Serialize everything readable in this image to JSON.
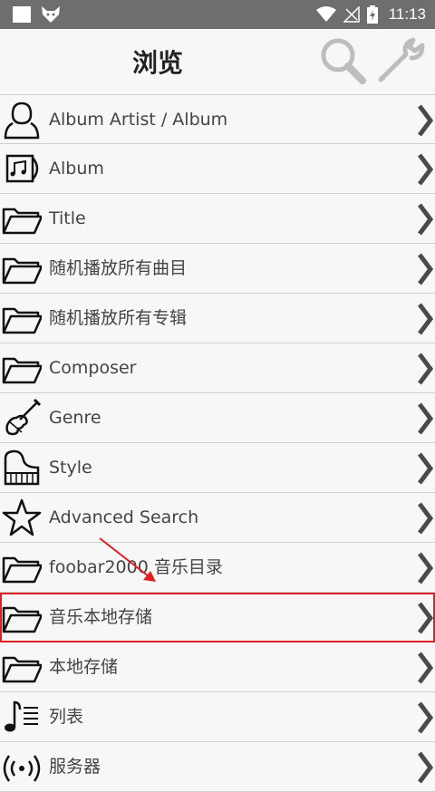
{
  "status": {
    "time": "11:13"
  },
  "header": {
    "title": "浏览"
  },
  "items": [
    {
      "label": "Album Artist / Album",
      "icon": "person-icon"
    },
    {
      "label": "Album",
      "icon": "album-icon"
    },
    {
      "label": "Title",
      "icon": "folder-icon"
    },
    {
      "label": "随机播放所有曲目",
      "icon": "folder-icon"
    },
    {
      "label": "随机播放所有专辑",
      "icon": "folder-icon"
    },
    {
      "label": "Composer",
      "icon": "folder-icon"
    },
    {
      "label": "Genre",
      "icon": "violin-icon"
    },
    {
      "label": "Style",
      "icon": "piano-icon"
    },
    {
      "label": "Advanced Search",
      "icon": "star-icon"
    },
    {
      "label": "foobar2000 音乐目录",
      "icon": "folder-icon"
    },
    {
      "label": "音乐本地存储",
      "icon": "folder-icon"
    },
    {
      "label": "本地存储",
      "icon": "folder-icon"
    },
    {
      "label": "列表",
      "icon": "playlist-icon"
    },
    {
      "label": "服务器",
      "icon": "broadcast-icon"
    }
  ],
  "highlighted_item": "音乐本地存储"
}
